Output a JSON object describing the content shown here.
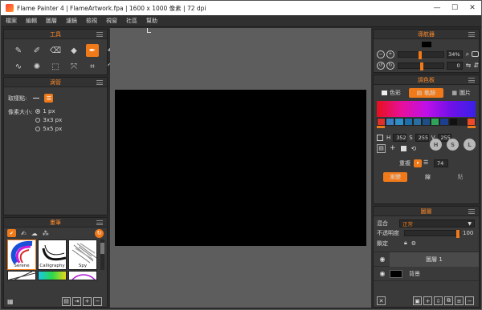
{
  "app": {
    "title": "Flame Painter 4 | FlameArtwork.fpa | 1600 x 1000 像素 | 72 dpi",
    "window_buttons": [
      "—",
      "☐",
      "✕"
    ]
  },
  "menu": [
    "檔案",
    "編輯",
    "圖層",
    "濾鏡",
    "檢視",
    "視窗",
    "社區",
    "幫助"
  ],
  "tools_panel": {
    "title": "工具",
    "tools": [
      {
        "icon": "pen-icon",
        "glyph": "✎"
      },
      {
        "icon": "pencil-icon",
        "glyph": "✐"
      },
      {
        "icon": "eraser-icon",
        "glyph": "⌫"
      },
      {
        "icon": "bucket-icon",
        "glyph": "◆"
      },
      {
        "icon": "eyedropper-icon",
        "glyph": "✒"
      },
      {
        "icon": "undo-icon",
        "glyph": "↶"
      },
      {
        "icon": "wave-icon",
        "glyph": "∿"
      },
      {
        "icon": "blob-icon",
        "glyph": "✺"
      },
      {
        "icon": "select-icon",
        "glyph": "⬚"
      },
      {
        "icon": "transform-icon",
        "glyph": "⤧"
      },
      {
        "icon": "crop-icon",
        "glyph": "⌗"
      },
      {
        "icon": "redo-icon",
        "glyph": "↷"
      }
    ],
    "active_tool": 4
  },
  "dropper_panel": {
    "title": "滴管",
    "sample_label": "取樣點:",
    "pixel_size_label": "像素大小:",
    "options": [
      "1 px",
      "3x3 px",
      "5x5 px"
    ],
    "selected_option": 0
  },
  "brushes_panel": {
    "title": "畫筆",
    "brushes": [
      "Serene",
      "Calligraphy",
      "Spy"
    ]
  },
  "navigator_panel": {
    "title": "導航器",
    "zoom": "34%",
    "rotation": "0"
  },
  "color_panel": {
    "title": "調色板",
    "tabs": [
      "色彩",
      "軌跡",
      "圖片"
    ],
    "active_tab": 1,
    "swatches": [
      "#e0302e",
      "#3a7fc1",
      "#2f8ec8",
      "#1c6fa8",
      "#2a6ea0",
      "#1d4e86",
      "#2fa35a",
      "#1d3f8f",
      "#111111",
      "#222222",
      "#ee4a2a"
    ],
    "h": "352",
    "s": "255",
    "v": "255",
    "hsl": [
      "H",
      "S",
      "L"
    ],
    "repeat_label": "重複",
    "repeat_value": "74",
    "mode_tabs": [
      "漸變",
      "線",
      "點"
    ],
    "active_mode": 0
  },
  "layers_panel": {
    "title": "圖層",
    "blend_label": "混合",
    "blend_value": "正常",
    "opacity_label": "不透明度",
    "opacity_value": "100",
    "lock_label": "鎖定",
    "layers": [
      "圖層 1",
      "背景"
    ]
  },
  "colors": {
    "accent": "#f07a1a",
    "panel_bg": "#3a3a3a",
    "canvas_bg": "#5d5d5d"
  }
}
